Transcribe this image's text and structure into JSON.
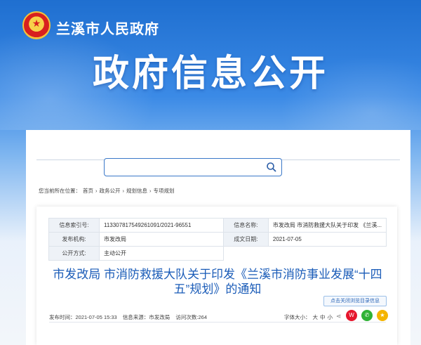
{
  "header": {
    "site_name": "兰溪市人民政府",
    "page_title": "政府信息公开"
  },
  "search": {
    "placeholder": "",
    "value": ""
  },
  "breadcrumb": {
    "prefix": "您当前所在位置：",
    "items": [
      "首页",
      "政务公开",
      "规划信息",
      "专项规划"
    ],
    "separator": "›"
  },
  "meta": {
    "index_label": "信息索引号:",
    "index_value": "113307817549261091/2021-96551",
    "name_label": "信息名称:",
    "name_value": "市发改局 市消防救援大队关于印发 《兰溪...",
    "org_label": "发布机构:",
    "org_value": "市发改局",
    "date_label": "成文日期:",
    "date_value": "2021-07-05",
    "mode_label": "公开方式:",
    "mode_value": "主动公开"
  },
  "article": {
    "title": "市发改局 市消防救援大队关于印发《兰溪市消防事业发展“十四五”规划》的通知",
    "download_label": "点击关闭浏览目录信息",
    "publish_time": "发布时间：2021-07-05 15:33",
    "source": "信息来源：市发改局",
    "visits": "访问次数:264",
    "font_label": "字体大小：",
    "font_big": "大",
    "font_mid": "中",
    "font_small": "小"
  },
  "colors": {
    "brand_blue": "#1f6fd0",
    "title_blue": "#1b5cb8"
  }
}
